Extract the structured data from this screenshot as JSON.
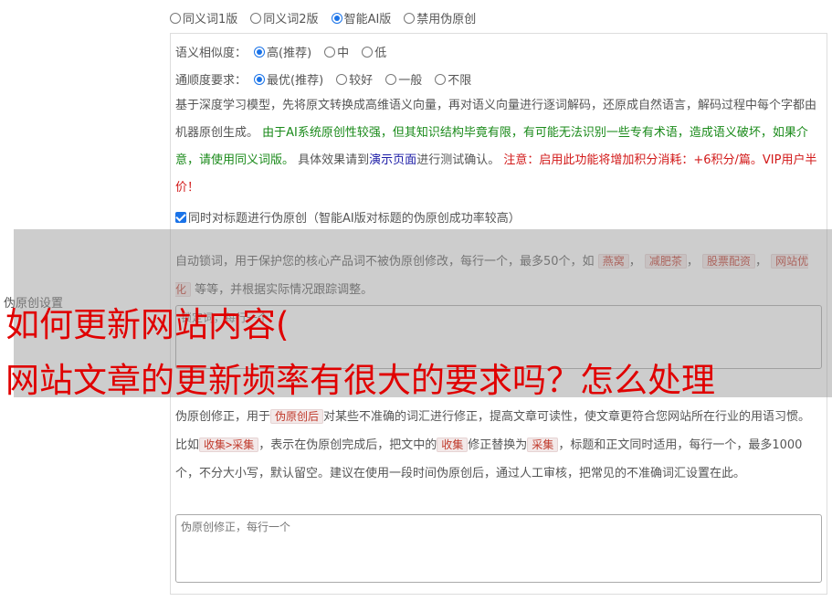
{
  "top_modes": [
    {
      "label": "同义词1版",
      "selected": false
    },
    {
      "label": "同义词2版",
      "selected": false
    },
    {
      "label": "智能AI版",
      "selected": true
    },
    {
      "label": "禁用伪原创",
      "selected": false
    }
  ],
  "similarity": {
    "label": "语义相似度：",
    "options": [
      {
        "label": "高(推荐)",
        "selected": true
      },
      {
        "label": "中",
        "selected": false
      },
      {
        "label": "低",
        "selected": false
      }
    ]
  },
  "fluency": {
    "label": "通顺度要求：",
    "options": [
      {
        "label": "最优(推荐)",
        "selected": true
      },
      {
        "label": "较好",
        "selected": false
      },
      {
        "label": "一般",
        "selected": false
      },
      {
        "label": "不限",
        "selected": false
      }
    ]
  },
  "description": {
    "part1": "基于深度学习模型，先将原文转换成高维语义向量，再对语义向量进行逐词解码，还原成自然语言，解码过程中每个字都由机器原创生成。",
    "green": "由于AI系统原创性较强，但其知识结构毕竟有限，有可能无法识别一些专有术语，造成语义破坏，如果介意，请使用同义词版。",
    "part2": "具体效果请到",
    "link": "演示页面",
    "part3": "进行测试确认。",
    "red": "注意：启用此功能将增加积分消耗：+6积分/篇。VIP用户半价！"
  },
  "title_checkbox": {
    "label": "同时对标题进行伪原创（智能AI版对标题的伪原创成功率较高）",
    "checked": true
  },
  "lock_words": {
    "intro": "自动锁词，用于保护您的核心产品词不被伪原创修改，每行一个，最多50个，如",
    "tags": [
      "燕窝",
      "减肥茶",
      "股票配资",
      "网站优化"
    ],
    "outro": "等等，并根据实际情况跟踪调整。",
    "placeholder": "锁定词，每行一个"
  },
  "side_label": "伪原创设置",
  "correction": {
    "t1": "伪原创修正，用于",
    "tag1": "伪原创后",
    "t2": "对某些不准确的词汇进行修正，提高文章可读性，使文章更符合您网站所在行业的用语习惯。比如",
    "tag2": "收集>采集",
    "t3": "，表示在伪原创完成后，把文中的",
    "tag3": "收集",
    "t4": "修正替换为",
    "tag4": "采集",
    "t5": "，标题和正文同时适用，每行一个，最多1000个，不分大小写，默认留空。建议在使用一段时间伪原创后，通过人工审核，把常见的不准确词汇设置在此。",
    "placeholder": "伪原创修正，每行一个"
  },
  "headline": {
    "line1": "如何更新网站内容(",
    "line2": "网站文章的更新频率有很大的要求吗？怎么处理"
  }
}
